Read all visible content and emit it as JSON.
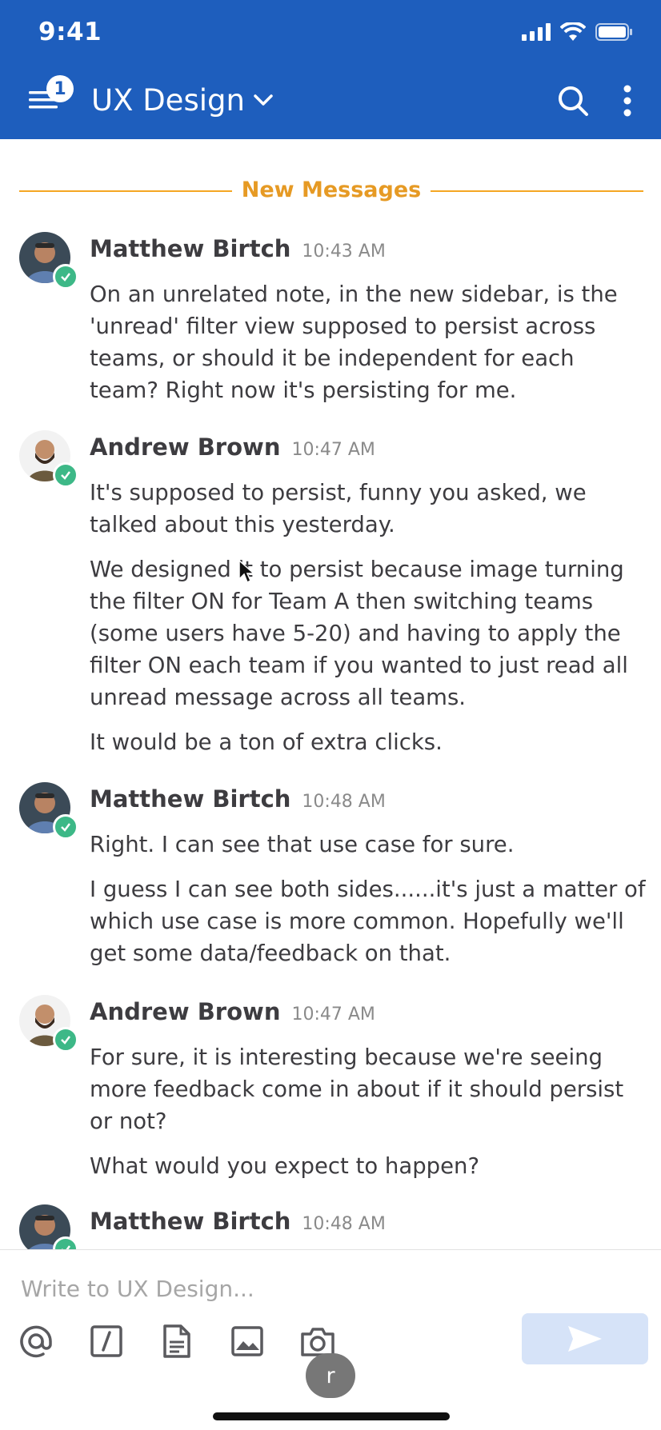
{
  "status_bar": {
    "time": "9:41"
  },
  "header": {
    "unread_badge": "1",
    "channel_title": "UX Design",
    "background_color": "#1e5ebd"
  },
  "divider": {
    "label": "New Messages",
    "color": "#f5a623"
  },
  "posts": [
    {
      "author": "Matthew Birtch",
      "time": "10:43 AM",
      "messages": [
        "On an unrelated note, in the new sidebar, is the 'unread' filter view supposed to persist across teams, or should it be independent for each team? Right now it's persisting for me."
      ]
    },
    {
      "author": "Andrew Brown",
      "time": "10:47 AM",
      "messages": [
        "It's supposed to persist, funny you asked, we talked about this yesterday.",
        "We designed it to persist because image turning the filter ON for Team A then switching teams (some users have 5-20) and having to apply the filter ON each team if you wanted to just read all unread message across all teams.",
        "It would be a ton of extra clicks."
      ]
    },
    {
      "author": "Matthew Birtch",
      "time": "10:48 AM",
      "messages": [
        "Right. I can see that use case for sure.",
        "I guess I can see both sides......it's just a matter of which use case is more common. Hopefully we'll get some data/feedback on that."
      ]
    },
    {
      "author": "Andrew Brown",
      "time": "10:47 AM",
      "messages": [
        "For sure, it is interesting because we're seeing more feedback come in about if it should persist or not?",
        "What would you expect to happen?"
      ]
    },
    {
      "author": "Matthew Birtch",
      "time": "10:48 AM",
      "messages": []
    }
  ],
  "composer": {
    "placeholder": "Write to UX Design...",
    "tools": [
      "at-mention-icon",
      "slash-command-icon",
      "file-icon",
      "image-icon",
      "camera-icon"
    ],
    "recent_bubble": "r"
  }
}
